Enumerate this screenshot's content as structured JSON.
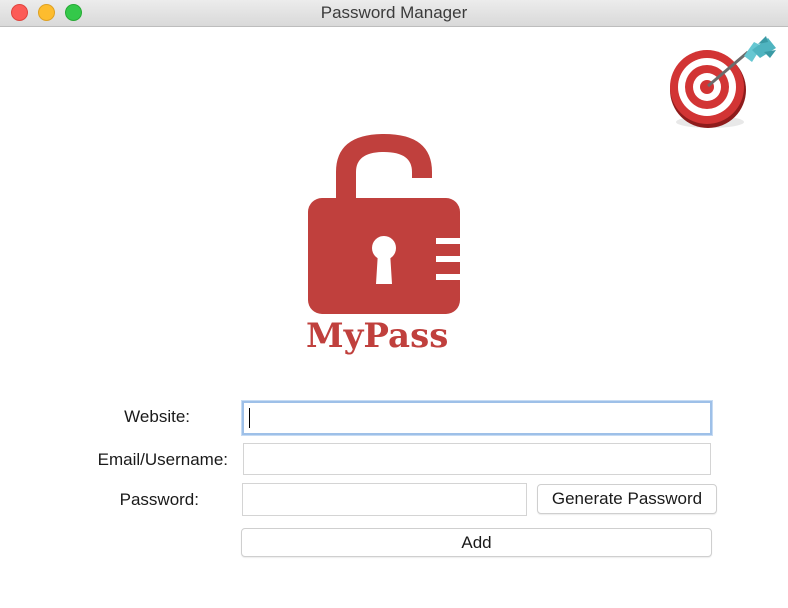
{
  "window": {
    "title": "Password Manager"
  },
  "logo": {
    "text": "MyPass"
  },
  "icons": {
    "corner": "target-dart-icon",
    "logo": "padlock-open-icon"
  },
  "colors": {
    "brand_red": "#c0403d"
  },
  "form": {
    "website_label": "Website:",
    "website_value": "",
    "email_label": "Email/Username:",
    "email_value": "",
    "password_label": "Password:",
    "password_value": "",
    "generate_button": "Generate Password",
    "add_button": "Add"
  }
}
